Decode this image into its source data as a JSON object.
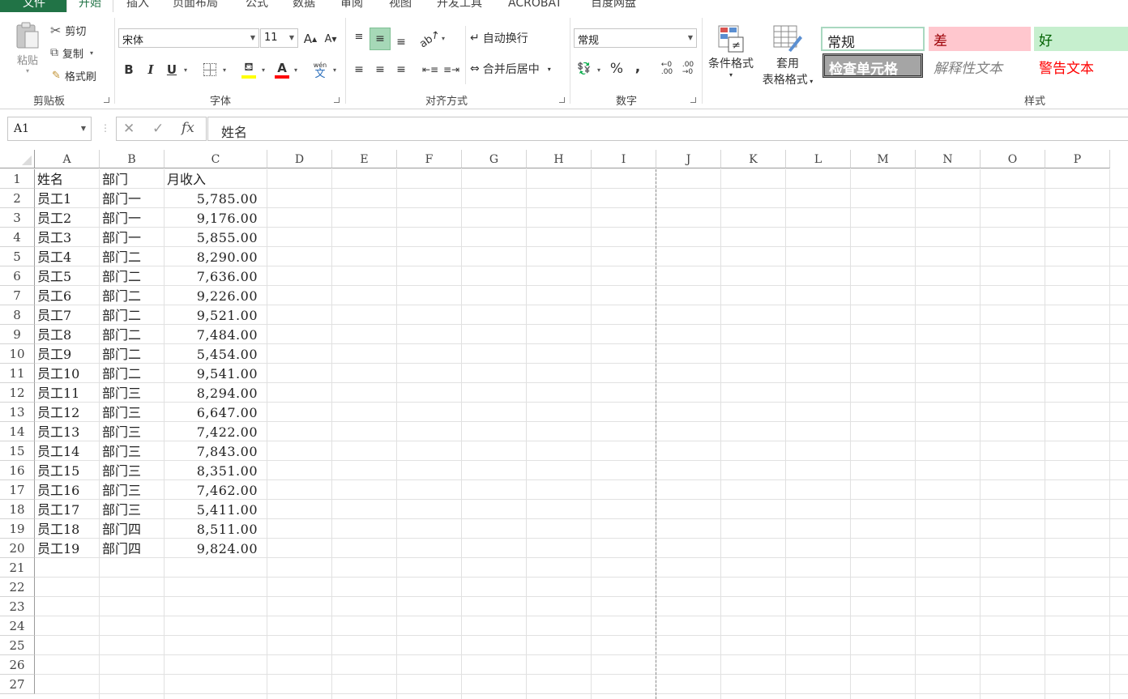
{
  "tabs": [
    "文件",
    "开始",
    "插入",
    "页面布局",
    "公式",
    "数据",
    "审阅",
    "视图",
    "开发工具",
    "ACROBAT",
    "百度网盘"
  ],
  "ribbon": {
    "clipboard": {
      "paste": "粘贴",
      "cut": "剪切",
      "copy": "复制",
      "format_painter": "格式刷",
      "label": "剪贴板"
    },
    "font": {
      "name": "宋体",
      "size": "11",
      "bold": "B",
      "italic": "I",
      "underline": "U",
      "wen": "wén",
      "wen2": "文",
      "label": "字体",
      "grow": "A",
      "shrink": "A",
      "font_color_glyph": "A"
    },
    "alignment": {
      "wrap": "自动换行",
      "merge": "合并后居中",
      "label": "对齐方式"
    },
    "number": {
      "format": "常规",
      "percent": "%",
      "comma": ",",
      "label": "数字"
    },
    "styles": {
      "conditional": "条件格式",
      "table_format_1": "套用",
      "table_format_2": "表格格式",
      "normal": "常规",
      "bad": "差",
      "good": "好",
      "check_cell": "检查单元格",
      "explanatory": "解释性文本",
      "warning": "警告文本",
      "label": "样式"
    }
  },
  "formula_bar": {
    "name_box": "A1",
    "cancel": "✕",
    "enter": "✓",
    "fx": "fx",
    "content": "姓名"
  },
  "columns": [
    "A",
    "B",
    "C",
    "D",
    "E",
    "F",
    "G",
    "H",
    "I",
    "J",
    "K",
    "L",
    "M",
    "N",
    "O",
    "P"
  ],
  "row_numbers": [
    "1",
    "2",
    "3",
    "4",
    "5",
    "6",
    "7",
    "8",
    "9",
    "10",
    "11",
    "12",
    "13",
    "14",
    "15",
    "16",
    "17",
    "18",
    "19",
    "20",
    "21",
    "22",
    "23",
    "24",
    "25",
    "26",
    "27"
  ],
  "table": {
    "header": [
      "姓名",
      "部门",
      "月收入"
    ],
    "rows": [
      [
        "员工1",
        "部门一",
        "5,785.00"
      ],
      [
        "员工2",
        "部门一",
        "9,176.00"
      ],
      [
        "员工3",
        "部门一",
        "5,855.00"
      ],
      [
        "员工4",
        "部门二",
        "8,290.00"
      ],
      [
        "员工5",
        "部门二",
        "7,636.00"
      ],
      [
        "员工6",
        "部门二",
        "9,226.00"
      ],
      [
        "员工7",
        "部门二",
        "9,521.00"
      ],
      [
        "员工8",
        "部门二",
        "7,484.00"
      ],
      [
        "员工9",
        "部门二",
        "5,454.00"
      ],
      [
        "员工10",
        "部门二",
        "9,541.00"
      ],
      [
        "员工11",
        "部门三",
        "8,294.00"
      ],
      [
        "员工12",
        "部门三",
        "6,647.00"
      ],
      [
        "员工13",
        "部门三",
        "7,422.00"
      ],
      [
        "员工14",
        "部门三",
        "7,843.00"
      ],
      [
        "员工15",
        "部门三",
        "8,351.00"
      ],
      [
        "员工16",
        "部门三",
        "7,462.00"
      ],
      [
        "员工17",
        "部门三",
        "5,411.00"
      ],
      [
        "员工18",
        "部门四",
        "8,511.00"
      ],
      [
        "员工19",
        "部门四",
        "9,824.00"
      ]
    ]
  },
  "colors": {
    "accent": "#217346",
    "bad_bg": "#ffc7ce",
    "bad_fg": "#9c0006",
    "good_bg": "#c6efce",
    "good_fg": "#006100",
    "warning_fg": "#ff0000",
    "check_bg": "#a5a5a5"
  }
}
